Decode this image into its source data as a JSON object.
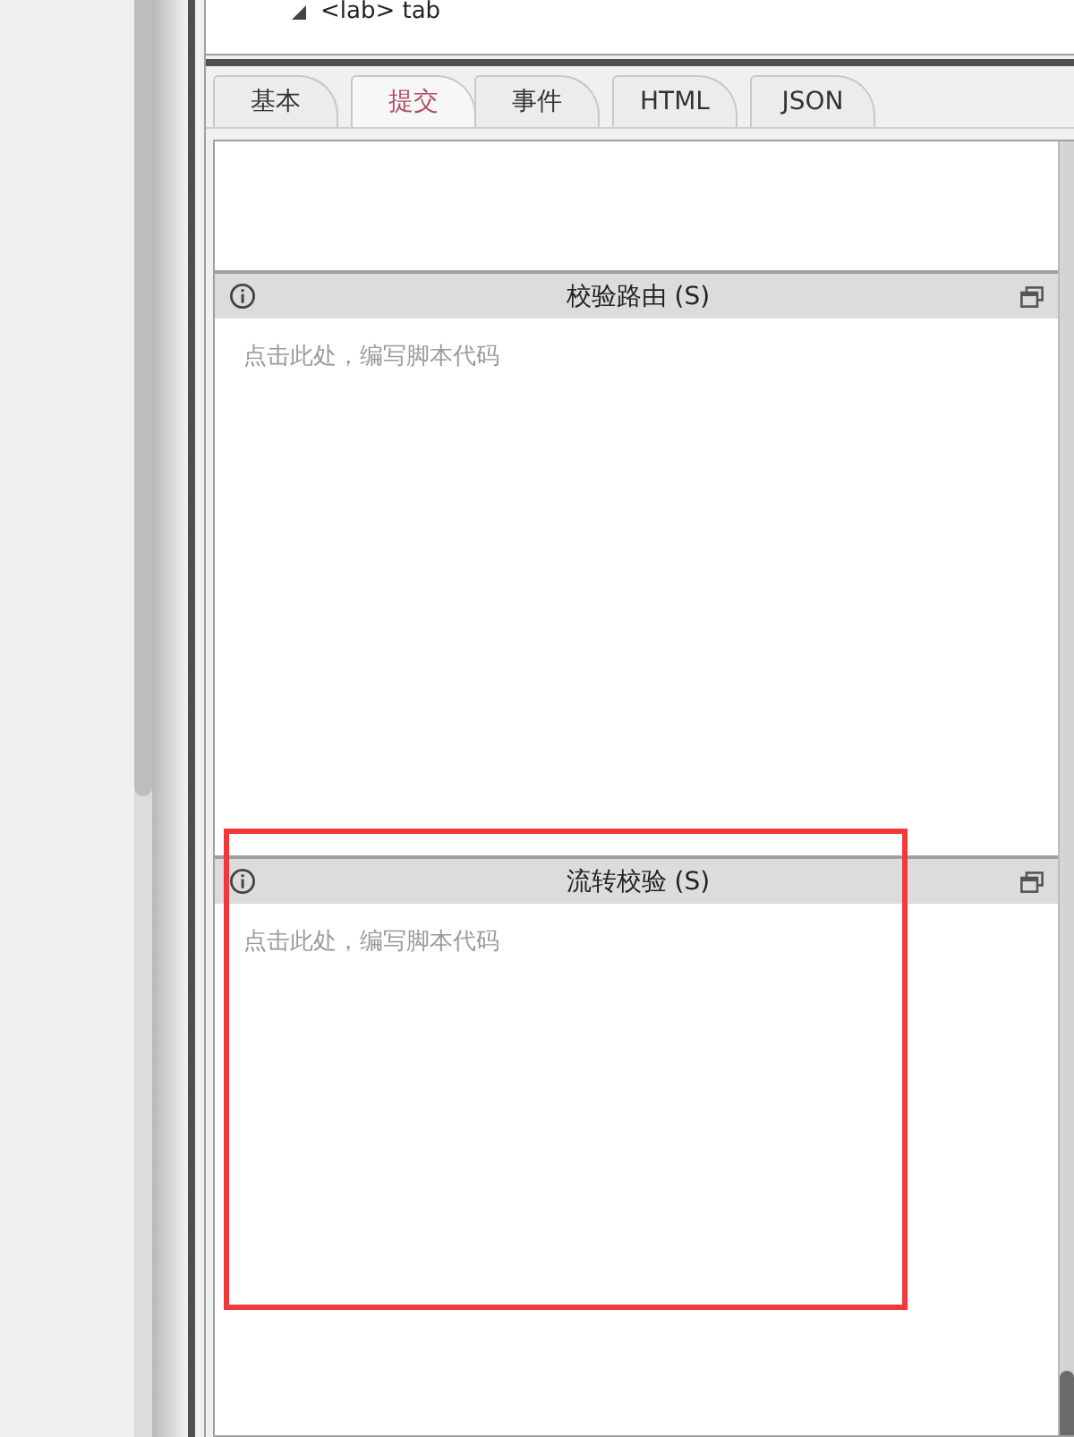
{
  "tree": {
    "nodes": [
      {
        "label": "<lab> tab",
        "expanded": true
      }
    ]
  },
  "tabs": [
    {
      "label": "基本",
      "selected": false
    },
    {
      "label": "提交",
      "selected": true
    },
    {
      "label": "事件",
      "selected": false
    },
    {
      "label": "HTML",
      "selected": false
    },
    {
      "label": "JSON",
      "selected": false
    }
  ],
  "sections": [
    {
      "title": "校验路由 (S)",
      "placeholder": "点击此处，编写脚本代码",
      "highlighted": false
    },
    {
      "title": "流转校验 (S)",
      "placeholder": "点击此处，编写脚本代码",
      "highlighted": true
    }
  ]
}
